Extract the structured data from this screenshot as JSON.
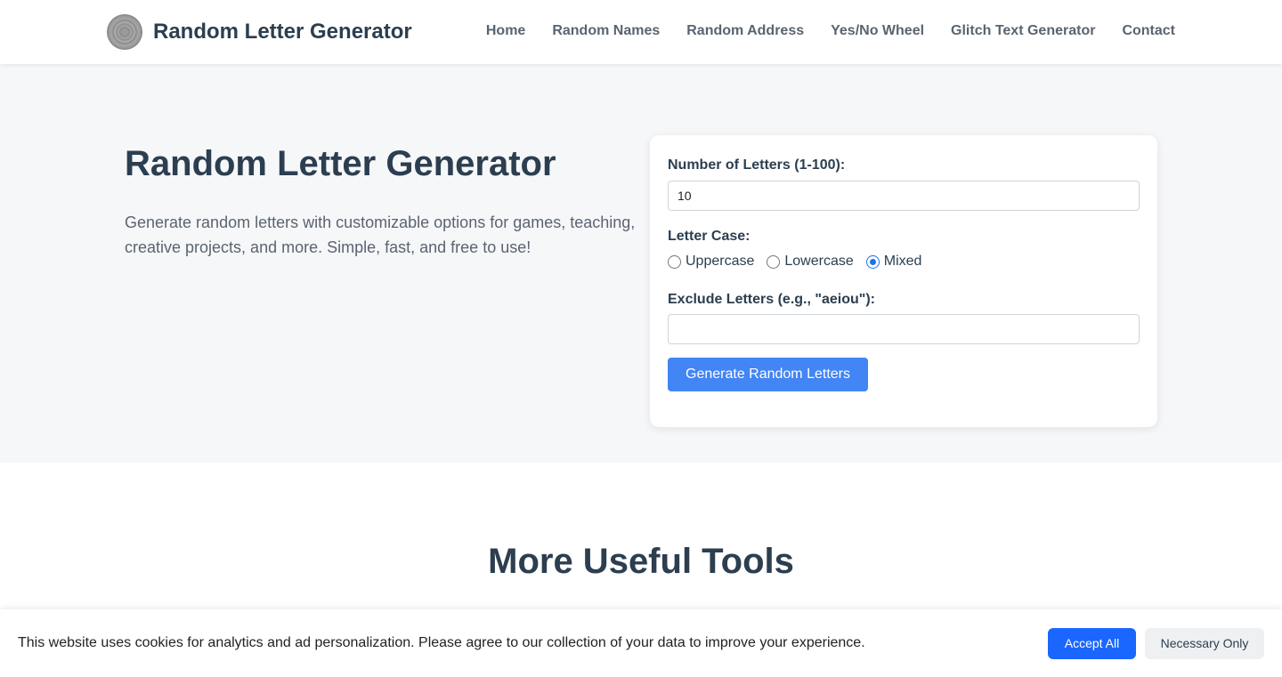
{
  "header": {
    "logo_icon": "circular-pattern-logo",
    "site_title": "Random Letter Generator",
    "nav": [
      {
        "label": "Home"
      },
      {
        "label": "Random Names"
      },
      {
        "label": "Random Address"
      },
      {
        "label": "Yes/No Wheel"
      },
      {
        "label": "Glitch Text Generator"
      },
      {
        "label": "Contact"
      }
    ]
  },
  "hero": {
    "title": "Random Letter Generator",
    "description": "Generate random letters with customizable options for games, teaching, creative projects, and more. Simple, fast, and free to use!"
  },
  "generator": {
    "count_label": "Number of Letters (1-100):",
    "count_value": "10",
    "case_label": "Letter Case:",
    "case_options": [
      {
        "label": "Uppercase",
        "checked": false
      },
      {
        "label": "Lowercase",
        "checked": false
      },
      {
        "label": "Mixed",
        "checked": true
      }
    ],
    "exclude_label": "Exclude Letters (e.g., \"aeiou\"):",
    "exclude_value": "",
    "button_label": "Generate Random Letters"
  },
  "more_tools": {
    "title": "More Useful Tools"
  },
  "cookie_bar": {
    "text": "This website uses cookies for analytics and ad personalization. Please agree to our collection of your data to improve your experience.",
    "accept_label": "Accept All",
    "necessary_label": "Necessary Only"
  },
  "colors": {
    "accent": "#4285f4",
    "accept_button": "#1a66ff",
    "heading": "#2c3e50",
    "hero_bg": "#f6f7f9"
  }
}
